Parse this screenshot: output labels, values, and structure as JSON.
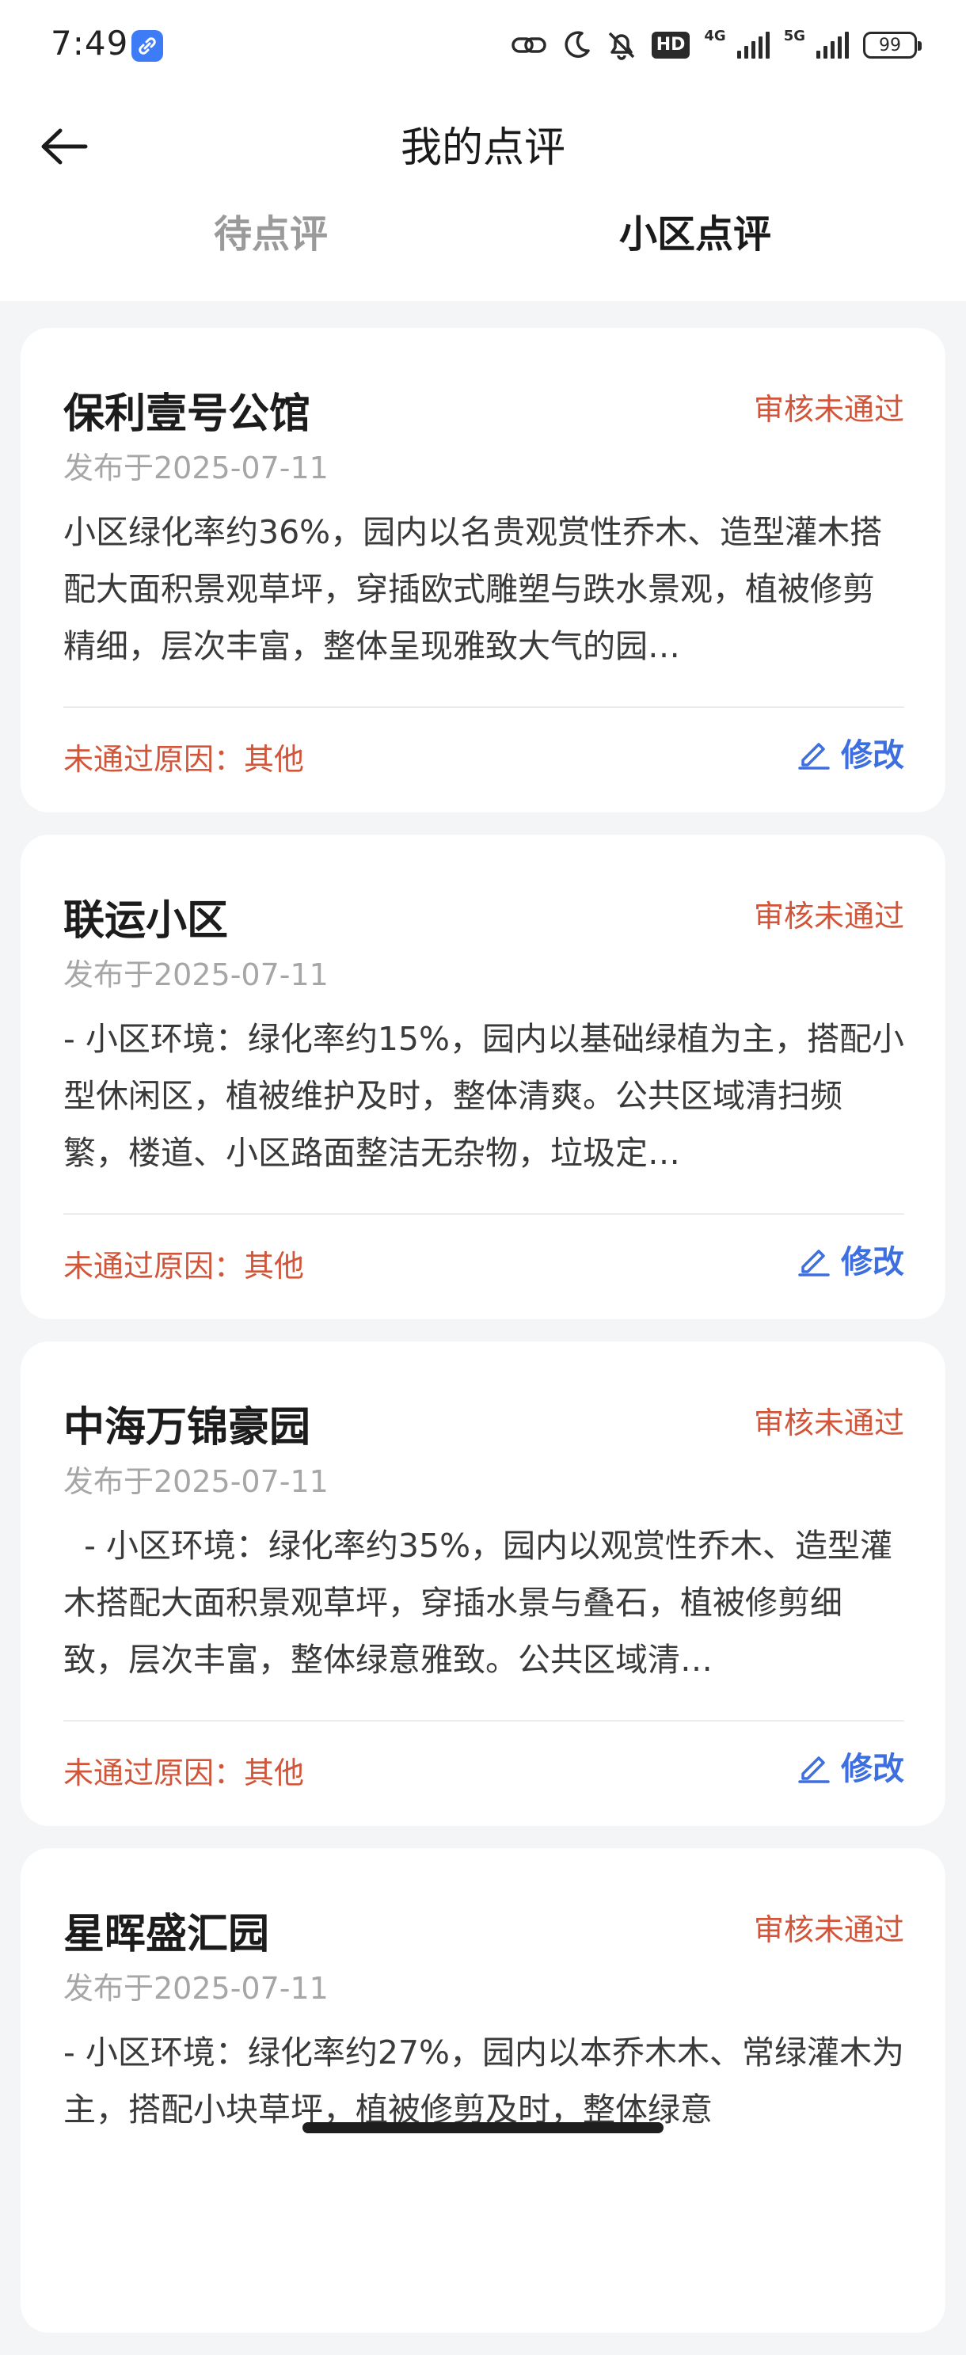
{
  "status_bar": {
    "time": "7:49",
    "hd_label": "HD",
    "net_primary": "4G",
    "net_secondary": "5G",
    "battery": "99"
  },
  "header": {
    "title": "我的点评",
    "tabs": [
      {
        "label": "待点评",
        "active": false
      },
      {
        "label": "小区点评",
        "active": true
      }
    ]
  },
  "reviews": [
    {
      "name": "保利壹号公馆",
      "status": "审核未通过",
      "date": "发布于2025-07-11",
      "content": "小区绿化率约36%，园内以名贵观赏性乔木、造型灌木搭配大面积景观草坪，穿插欧式雕塑与跌水景观，植被修剪精细，层次丰富，整体呈现雅致大气的园…",
      "reason": "未通过原因：其他",
      "edit_label": "修改"
    },
    {
      "name": "联运小区",
      "status": "审核未通过",
      "date": "发布于2025-07-11",
      "content": "- 小区环境：绿化率约15%，园内以基础绿植为主，搭配小型休闲区，植被维护及时，整体清爽。公共区域清扫频繁，楼道、小区路面整洁无杂物，垃圾定…",
      "reason": "未通过原因：其他",
      "edit_label": "修改"
    },
    {
      "name": "中海万锦豪园",
      "status": "审核未通过",
      "date": "发布于2025-07-11",
      "content": "  - 小区环境：绿化率约35%，园内以观赏性乔木、造型灌木搭配大面积景观草坪，穿插水景与叠石，植被修剪细致，层次丰富，整体绿意雅致。公共区域清…",
      "reason": "未通过原因：其他",
      "edit_label": "修改"
    },
    {
      "name": "星晖盛汇园",
      "status": "审核未通过",
      "date": "发布于2025-07-11",
      "content": "- 小区环境：绿化率约27%，园内以本乔木木、常绿灌木为主，搭配小块草坪，植被修剪及时，整体绿意",
      "reason": "",
      "edit_label": ""
    }
  ],
  "colors": {
    "status_red": "#d2553a",
    "link_blue": "#3d6fe0",
    "page_bg": "#f4f5f7"
  },
  "icons": [
    "link-icon",
    "chain-link-icon",
    "moon-icon",
    "bell-muted-icon",
    "back-arrow-icon",
    "edit-pencil-icon"
  ]
}
